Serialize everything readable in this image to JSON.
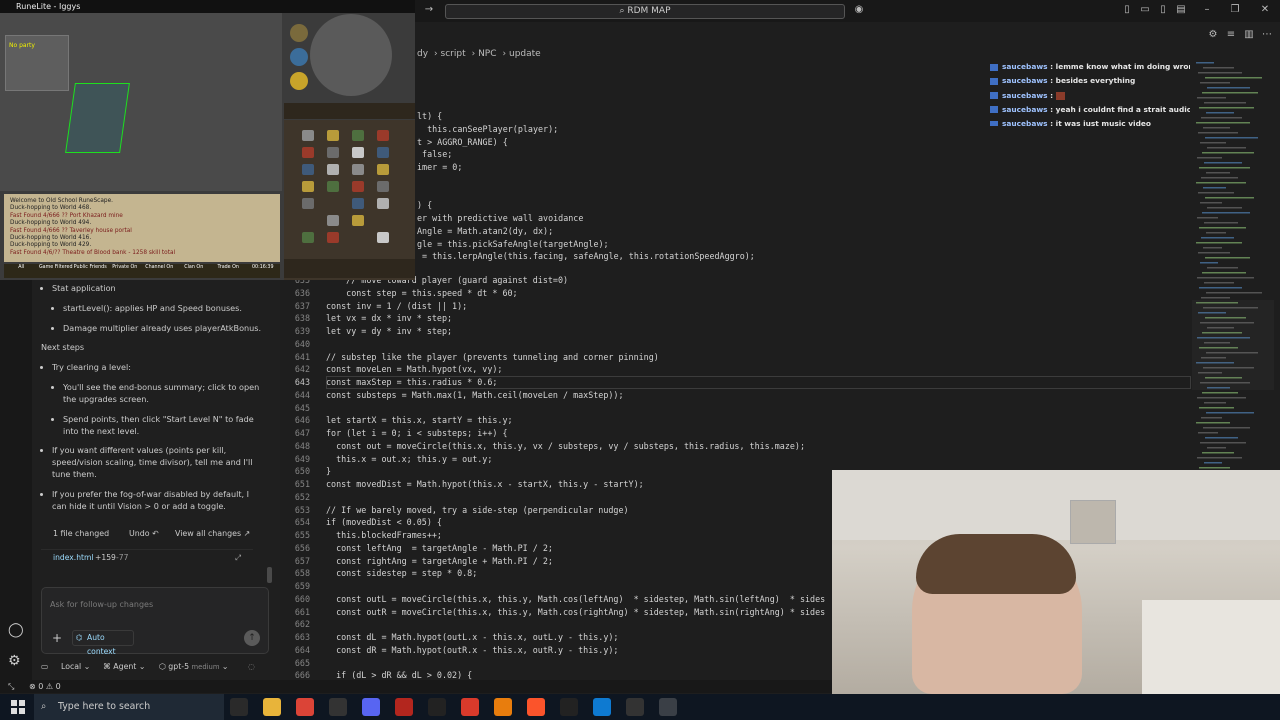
{
  "game": {
    "window_title": "RuneLite - Iggys",
    "party_label": "No party",
    "chat_lines": [
      "Welcome to Old School RuneScape.",
      "Duck-hopping to World 468.",
      "Fast Found 4/666 ?? Port Khazard mine",
      "Duck-hopping to World 494.",
      "Fast Found 4/666 ?? Taverley house portal",
      "Duck-hopping to World 416.",
      "Duck-hopping to World 429.",
      "Fast Found 4/6/?? Theatre of Blood bank - 1258 skill total"
    ],
    "chat_tabs": [
      "All",
      "Game Filtered",
      "Public Friends",
      "Private On",
      "Channel On",
      "Clan On",
      "Trade On",
      "00:16:39"
    ]
  },
  "editor": {
    "search_label": "RDM MAP",
    "breadcrumb": [
      "dy",
      "script",
      "NPC",
      "update"
    ],
    "current_line": 643,
    "upper_lines": [
      "lt) {",
      "  this.canSeePlayer(player);",
      "t > AGGRO_RANGE) {",
      " false;",
      "imer = 0;",
      "",
      "",
      ") {",
      "er with predictive wall avoidance",
      "Angle = Math.atan2(dy, dx);",
      "gle = this.pickSafeAngle(targetAngle);",
      " = this.lerpAngle(this.facing, safeAngle, this.rotationSpeedAggro);"
    ],
    "code_lines": [
      {
        "n": 635,
        "t": "    // move toward player (guard against dist=0)"
      },
      {
        "n": 636,
        "t": "    const step = this.speed * dt * 60;"
      },
      {
        "n": 637,
        "t": "const inv = 1 / (dist || 1);"
      },
      {
        "n": 638,
        "t": "let vx = dx * inv * step;"
      },
      {
        "n": 639,
        "t": "let vy = dy * inv * step;"
      },
      {
        "n": 640,
        "t": ""
      },
      {
        "n": 641,
        "t": "// substep like the player (prevents tunneling and corner pinning)"
      },
      {
        "n": 642,
        "t": "const moveLen = Math.hypot(vx, vy);"
      },
      {
        "n": 643,
        "t": "const maxStep = this.radius * 0.6;"
      },
      {
        "n": 644,
        "t": "const substeps = Math.max(1, Math.ceil(moveLen / maxStep));"
      },
      {
        "n": 645,
        "t": ""
      },
      {
        "n": 646,
        "t": "let startX = this.x, startY = this.y;"
      },
      {
        "n": 647,
        "t": "for (let i = 0; i < substeps; i++) {"
      },
      {
        "n": 648,
        "t": "  const out = moveCircle(this.x, this.y, vx / substeps, vy / substeps, this.radius, this.maze);"
      },
      {
        "n": 649,
        "t": "  this.x = out.x; this.y = out.y;"
      },
      {
        "n": 650,
        "t": "}"
      },
      {
        "n": 651,
        "t": "const movedDist = Math.hypot(this.x - startX, this.y - startY);"
      },
      {
        "n": 652,
        "t": ""
      },
      {
        "n": 653,
        "t": "// If we barely moved, try a side-step (perpendicular nudge)"
      },
      {
        "n": 654,
        "t": "if (movedDist < 0.05) {"
      },
      {
        "n": 655,
        "t": "  this.blockedFrames++;"
      },
      {
        "n": 656,
        "t": "  const leftAng  = targetAngle - Math.PI / 2;"
      },
      {
        "n": 657,
        "t": "  const rightAng = targetAngle + Math.PI / 2;"
      },
      {
        "n": 658,
        "t": "  const sidestep = step * 0.8;"
      },
      {
        "n": 659,
        "t": ""
      },
      {
        "n": 660,
        "t": "  const outL = moveCircle(this.x, this.y, Math.cos(leftAng)  * sidestep, Math.sin(leftAng)  * sides"
      },
      {
        "n": 661,
        "t": "  const outR = moveCircle(this.x, this.y, Math.cos(rightAng) * sidestep, Math.sin(rightAng) * sides"
      },
      {
        "n": 662,
        "t": ""
      },
      {
        "n": 663,
        "t": "  const dL = Math.hypot(outL.x - this.x, outL.y - this.y);"
      },
      {
        "n": 664,
        "t": "  const dR = Math.hypot(outR.x - this.x, outR.y - this.y);"
      },
      {
        "n": 665,
        "t": ""
      },
      {
        "n": 666,
        "t": "  if (dL > dR && dL > 0.02) {"
      }
    ]
  },
  "stream_chat": [
    {
      "user": "saucebaws",
      "msg": "lemme know what im doing wrong"
    },
    {
      "user": "saucebaws",
      "msg": "besides everything"
    },
    {
      "user": "saucebaws",
      "msg": ""
    },
    {
      "user": "saucebaws",
      "msg": "yeah i couldnt find a strait audio version"
    },
    {
      "user": "saucebaws",
      "msg": "it was just music video"
    }
  ],
  "agent_panel": {
    "stat_heading": "Stat application",
    "stat_items": [
      "startLevel(): applies HP and Speed bonuses.",
      "Damage multiplier already uses playerAtkBonus."
    ],
    "next_steps_heading": "Next steps",
    "try_clearing": "Try clearing a level:",
    "try_items": [
      "You'll see the end-bonus summary; click to open the upgrades screen.",
      "Spend points, then click \"Start Level N\" to fade into the next level."
    ],
    "tip1": "If you want different values (points per kill, speed/vision scaling, time divisor), tell me and I'll tune them.",
    "tip2": "If you prefer the fog-of-war disabled by default, I can hide it until Vision > 0 or add a toggle.",
    "files_changed": "1 file changed",
    "undo_label": "Undo",
    "view_all": "View all changes",
    "file_name": "index.html",
    "additions": "+159",
    "deletions": "-77",
    "followup_placeholder": "Ask for follow-up changes",
    "auto_context": "Auto context",
    "mode_local": "Local",
    "mode_agent": "Agent",
    "model": "gpt-5",
    "model_effort": "medium"
  },
  "statusbar": {
    "errors": "0",
    "warnings": "0"
  },
  "taskbar": {
    "search_placeholder": "Type here to search"
  }
}
